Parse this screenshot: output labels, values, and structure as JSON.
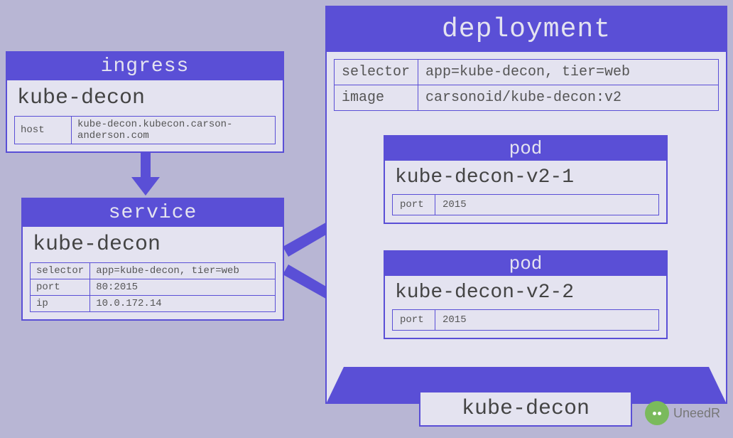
{
  "ingress": {
    "header": "ingress",
    "title": "kube-decon",
    "rows": [
      {
        "k": "host",
        "v": "kube-decon.kubecon.carson-anderson.com"
      }
    ]
  },
  "service": {
    "header": "service",
    "title": "kube-decon",
    "rows": [
      {
        "k": "selector",
        "v": "app=kube-decon, tier=web"
      },
      {
        "k": "port",
        "v": "80:2015"
      },
      {
        "k": "ip",
        "v": "10.0.172.14"
      }
    ]
  },
  "deployment": {
    "header": "deployment",
    "rows": [
      {
        "k": "selector",
        "v": "app=kube-decon, tier=web"
      },
      {
        "k": "image",
        "v": "carsonoid/kube-decon:v2"
      }
    ],
    "footer": "kube-decon",
    "pods": [
      {
        "header": "pod",
        "title": "kube-decon-v2-1",
        "rows": [
          {
            "k": "port",
            "v": "2015"
          }
        ]
      },
      {
        "header": "pod",
        "title": "kube-decon-v2-2",
        "rows": [
          {
            "k": "port",
            "v": "2015"
          }
        ]
      }
    ]
  },
  "watermark": "UneedR"
}
